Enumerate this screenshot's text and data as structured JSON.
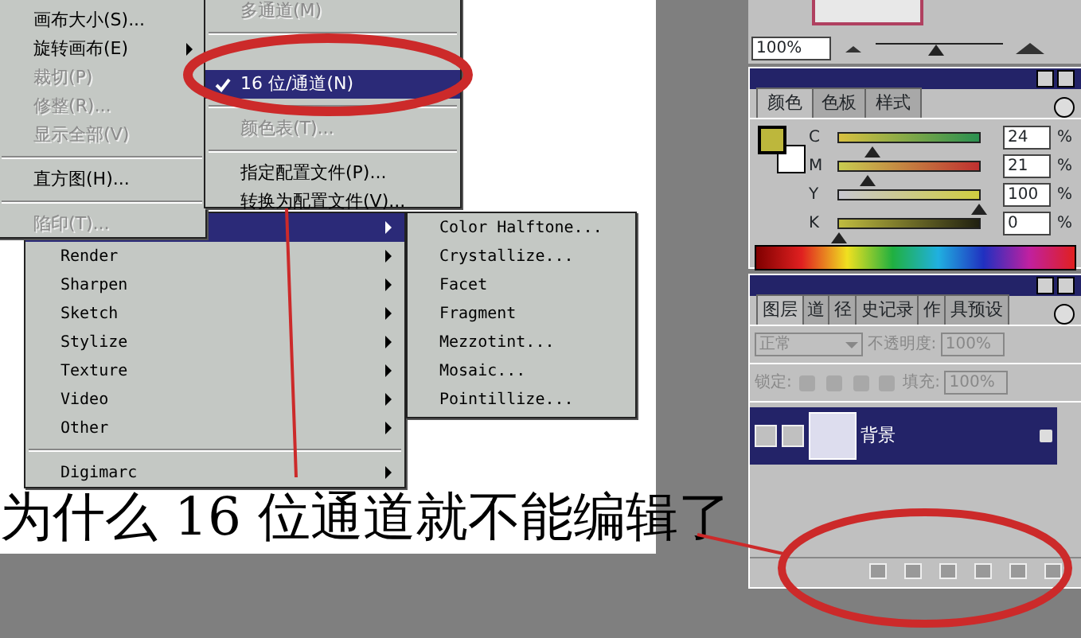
{
  "image_menu": {
    "items": [
      {
        "kind": "item",
        "label": "画布大小(S)...",
        "disabled": false,
        "submenu": false
      },
      {
        "kind": "item",
        "label": "旋转画布(E)",
        "disabled": false,
        "submenu": true
      },
      {
        "kind": "item",
        "label": "裁切(P)",
        "disabled": true,
        "submenu": false
      },
      {
        "kind": "item",
        "label": "修整(R)...",
        "disabled": true,
        "submenu": false
      },
      {
        "kind": "item",
        "label": "显示全部(V)",
        "disabled": true,
        "submenu": false
      },
      {
        "kind": "separator"
      },
      {
        "kind": "item",
        "label": "直方图(H)...",
        "disabled": false,
        "submenu": false
      },
      {
        "kind": "separator"
      },
      {
        "kind": "item",
        "label": "陷印(T)...",
        "disabled": true,
        "submenu": false
      }
    ]
  },
  "mode_submenu": {
    "items": [
      {
        "kind": "item",
        "label": "多通道(M)",
        "disabled": true,
        "checked": false,
        "selected": false
      },
      {
        "kind": "separator"
      },
      {
        "kind": "obscured"
      },
      {
        "kind": "item",
        "label": "16 位/通道(N)",
        "disabled": false,
        "checked": true,
        "selected": true
      },
      {
        "kind": "separator"
      },
      {
        "kind": "item",
        "label": "颜色表(T)...",
        "disabled": true,
        "checked": false,
        "selected": false
      },
      {
        "kind": "separator"
      },
      {
        "kind": "item",
        "label": "指定配置文件(P)...",
        "disabled": false,
        "checked": false,
        "selected": false
      },
      {
        "kind": "item",
        "label": "转换为配置文件(V)...",
        "disabled": false,
        "checked": false,
        "selected": false
      }
    ]
  },
  "filter_menu": {
    "items": [
      {
        "kind": "item",
        "selected": true,
        "submenu": true
      },
      {
        "kind": "item",
        "label": "Render",
        "selected": false,
        "submenu": true
      },
      {
        "kind": "item",
        "label": "Sharpen",
        "selected": false,
        "submenu": true
      },
      {
        "kind": "item",
        "label": "Sketch",
        "selected": false,
        "submenu": true
      },
      {
        "kind": "item",
        "label": "Stylize",
        "selected": false,
        "submenu": true
      },
      {
        "kind": "item",
        "label": "Texture",
        "selected": false,
        "submenu": true
      },
      {
        "kind": "item",
        "label": "Video",
        "selected": false,
        "submenu": true
      },
      {
        "kind": "item",
        "label": "Other",
        "selected": false,
        "submenu": true
      },
      {
        "kind": "separator"
      },
      {
        "kind": "item",
        "label": "Digimarc",
        "selected": false,
        "submenu": true
      }
    ]
  },
  "pixelate_submenu": {
    "items": [
      "Color Halftone...",
      "Crystallize...",
      "Facet",
      "Fragment",
      "Mezzotint...",
      "Mosaic...",
      "Pointillize..."
    ]
  },
  "caption": "为什么 16 位通道就不能编辑了",
  "navigator": {
    "zoom": "100%",
    "zoom_slider": {
      "level": 0.48
    }
  },
  "color_panel": {
    "tabs": [
      {
        "label": "颜色",
        "selected": true
      },
      {
        "label": "色板",
        "selected": false
      },
      {
        "label": "样式",
        "selected": false
      }
    ],
    "channels": [
      {
        "name": "C",
        "value": "24",
        "unit": "%",
        "level": 0.24
      },
      {
        "name": "M",
        "value": "21",
        "unit": "%",
        "level": 0.21
      },
      {
        "name": "Y",
        "value": "100",
        "unit": "%",
        "level": 1
      },
      {
        "name": "K",
        "value": "0",
        "unit": "%",
        "level": 0
      }
    ]
  },
  "layers_panel": {
    "tabs": [
      {
        "label": "图层",
        "selected": true
      },
      {
        "label": "道",
        "selected": false
      },
      {
        "label": "径",
        "selected": false
      },
      {
        "label": "史记录",
        "selected": false
      },
      {
        "label": "作",
        "selected": false
      },
      {
        "label": "具预设",
        "selected": false
      }
    ],
    "blend_mode": "正常",
    "opacity_label": "不透明度:",
    "opacity": "100%",
    "lock_label": "锁定:",
    "fill_label": "填充:",
    "fill": "100%",
    "layers": [
      {
        "name": "背景",
        "visible": true,
        "selected": true,
        "locked": true
      }
    ]
  }
}
